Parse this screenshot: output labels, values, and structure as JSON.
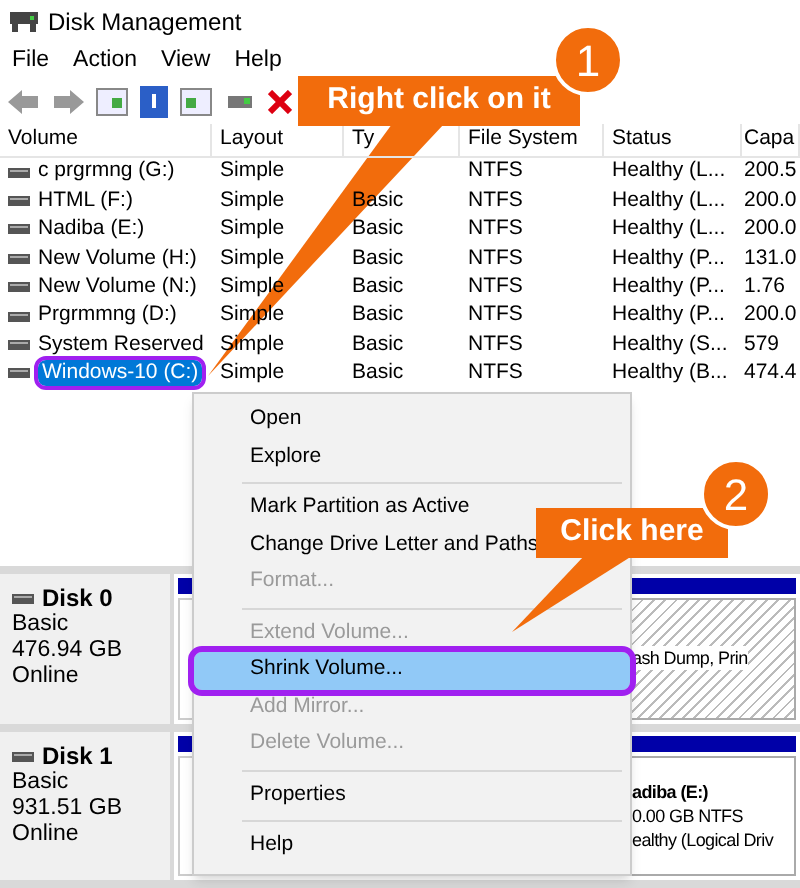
{
  "window": {
    "title": "Disk Management"
  },
  "menu": [
    "File",
    "Action",
    "View",
    "Help"
  ],
  "table": {
    "columns": [
      "Volume",
      "Layout",
      "Ty",
      "File System",
      "Status",
      "Capa"
    ],
    "rows": [
      {
        "cells": [
          "c prgrmng (G:)",
          "Simple",
          "",
          "NTFS",
          "Healthy (L...",
          "200.5"
        ],
        "selected": false
      },
      {
        "cells": [
          "HTML (F:)",
          "Simple",
          "Basic",
          "NTFS",
          "Healthy (L...",
          "200.0"
        ],
        "selected": false
      },
      {
        "cells": [
          "Nadiba (E:)",
          "Simple",
          "Basic",
          "NTFS",
          "Healthy (L...",
          "200.0"
        ],
        "selected": false
      },
      {
        "cells": [
          "New Volume (H:)",
          "Simple",
          "Basic",
          "NTFS",
          "Healthy (P...",
          "131.0"
        ],
        "selected": false
      },
      {
        "cells": [
          "New Volume (N:)",
          "Simple",
          "Basic",
          "NTFS",
          "Healthy (P...",
          "1.76"
        ],
        "selected": false
      },
      {
        "cells": [
          "Prgrmmng (D:)",
          "Simple",
          "Basic",
          "NTFS",
          "Healthy (P...",
          "200.0"
        ],
        "selected": false
      },
      {
        "cells": [
          "System Reserved",
          "Simple",
          "Basic",
          "NTFS",
          "Healthy (S...",
          "579"
        ],
        "selected": false
      },
      {
        "cells": [
          "Windows-10 (C:)",
          "Simple",
          "Basic",
          "NTFS",
          "Healthy (B...",
          "474.4"
        ],
        "selected": true
      }
    ]
  },
  "disks": [
    {
      "name": "Disk 0",
      "type": "Basic",
      "size": "476.94 GB",
      "status": "Online",
      "partition": {
        "kind": "hatched",
        "lines": [
          "ash Dump, Prin"
        ]
      }
    },
    {
      "name": "Disk 1",
      "type": "Basic",
      "size": "931.51 GB",
      "status": "Online",
      "partition": {
        "kind": "plain",
        "lines": [
          "adiba  (E:)",
          "0.00 GB NTFS",
          "ealthy (Logical Driv"
        ]
      }
    }
  ],
  "context_menu": [
    {
      "label": "Open",
      "disabled": false,
      "selected": false
    },
    {
      "label": "Explore",
      "disabled": false,
      "selected": false
    },
    {
      "kind": "separator"
    },
    {
      "label": "Mark Partition as Active",
      "disabled": false,
      "selected": false
    },
    {
      "label": "Change Drive Letter and Paths",
      "disabled": false,
      "selected": false
    },
    {
      "label": "Format...",
      "disabled": true,
      "selected": false
    },
    {
      "kind": "separator"
    },
    {
      "label": "Extend Volume...",
      "disabled": true,
      "selected": false
    },
    {
      "label": "Shrink Volume...",
      "disabled": false,
      "selected": true
    },
    {
      "label": "Add Mirror...",
      "disabled": true,
      "selected": false
    },
    {
      "label": "Delete Volume...",
      "disabled": true,
      "selected": false
    },
    {
      "kind": "separator"
    },
    {
      "label": "Properties",
      "disabled": false,
      "selected": false
    },
    {
      "kind": "separator"
    },
    {
      "label": "Help",
      "disabled": false,
      "selected": false
    }
  ],
  "callouts": [
    {
      "text": "Right click on it",
      "number": "1"
    },
    {
      "text": "Click here",
      "number": "2"
    }
  ]
}
